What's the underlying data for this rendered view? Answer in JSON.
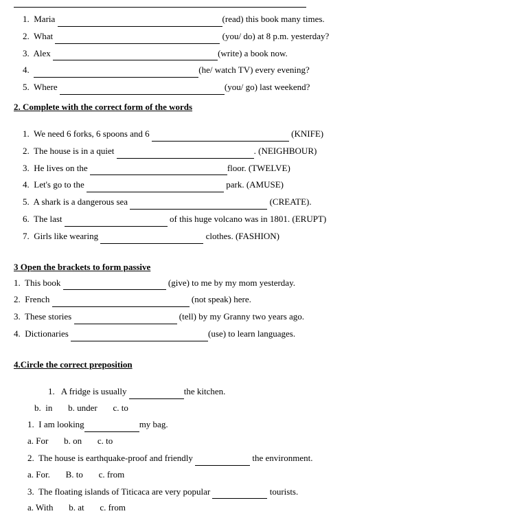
{
  "top_line": true,
  "section1": {
    "items": [
      {
        "num": "1.",
        "prefix": "Maria",
        "blank_size": "xl",
        "suffix": "(read) this book many times."
      },
      {
        "num": "2.",
        "prefix": "What",
        "blank_size": "xl",
        "suffix": "(you/ do) at  8 p.m. yesterday?"
      },
      {
        "num": "3.",
        "prefix": "Alex",
        "blank_size": "xl",
        "suffix": "(write) a book now."
      },
      {
        "num": "4.",
        "prefix": "",
        "blank_size": "xl",
        "suffix": "(he/ watch TV) every evening?"
      },
      {
        "num": "5.",
        "prefix": "Where",
        "blank_size": "xl",
        "suffix": "(you/ go) last weekend?"
      }
    ]
  },
  "section2": {
    "title": "2. Complete with the correct form of the words",
    "items": [
      {
        "num": "1.",
        "text": "We need 6 forks, 6 spoons and 6",
        "blank_size": "lg",
        "suffix": "(KNIFE)"
      },
      {
        "num": "2.",
        "text": "The house is in a quiet",
        "blank_size": "lg",
        "suffix": ". (NEIGHBOUR)"
      },
      {
        "num": "3.",
        "text": "He lives on the",
        "blank_size": "lg",
        "suffix": "floor. (TWELVE)"
      },
      {
        "num": "4.",
        "text": "Let's go to the",
        "blank_size": "lg",
        "suffix": "park. (AMUSE)"
      },
      {
        "num": "5.",
        "text": "A shark is a dangerous sea",
        "blank_size": "lg",
        "suffix": "(CREATE)."
      },
      {
        "num": "6.",
        "text": "The last",
        "blank_size": "md",
        "suffix": "of this huge volcano was in 1801. (ERUPT)"
      },
      {
        "num": "7.",
        "text": "Girls like wearing",
        "blank_size": "md",
        "suffix": "clothes. (FASHION)"
      }
    ]
  },
  "section3": {
    "title": "3 Open the brackets to form passive",
    "items": [
      {
        "num": "1.",
        "text": "This book",
        "blank_size": "md",
        "suffix": "(give) to me by my mom yesterday."
      },
      {
        "num": "2.",
        "text": "French",
        "blank_size": "lg",
        "suffix": "(not speak) here."
      },
      {
        "num": "3.",
        "text": "These stories",
        "blank_size": "md",
        "suffix": "(tell) by my Granny two years ago."
      },
      {
        "num": "4.",
        "text": "Dictionaries",
        "blank_size": "lg",
        "suffix": "(use) to learn languages."
      }
    ]
  },
  "section4": {
    "title": "4.Circle the correct preposition",
    "items": [
      {
        "num": "1.",
        "indent": true,
        "text": "A fridge is usually",
        "blank_size": "sm",
        "suffix": "the kitchen.",
        "options": {
          "label": "b.  in",
          "b": "b. under",
          "c": "c. to"
        },
        "option_style": "b"
      },
      {
        "num": "1.",
        "text": "I am looking",
        "blank_size": "sm",
        "suffix": "my bag.",
        "options": {
          "label": "a. For",
          "b": "b. on",
          "c": "c. to"
        },
        "option_style": "a"
      },
      {
        "num": "2.",
        "text": "The house is earthquake-proof and friendly",
        "blank_size": "sm",
        "suffix": "the environment.",
        "options": {
          "label": "a. For.",
          "b": "B. to",
          "c": "c. from"
        },
        "option_style": "a"
      },
      {
        "num": "3.",
        "text": "The floating islands of Titicaca are very popular",
        "blank_size": "sm",
        "suffix": "tourists.",
        "options": {
          "label": "a. With",
          "b": "b. at",
          "c": "c. from"
        },
        "option_style": "a"
      }
    ]
  }
}
